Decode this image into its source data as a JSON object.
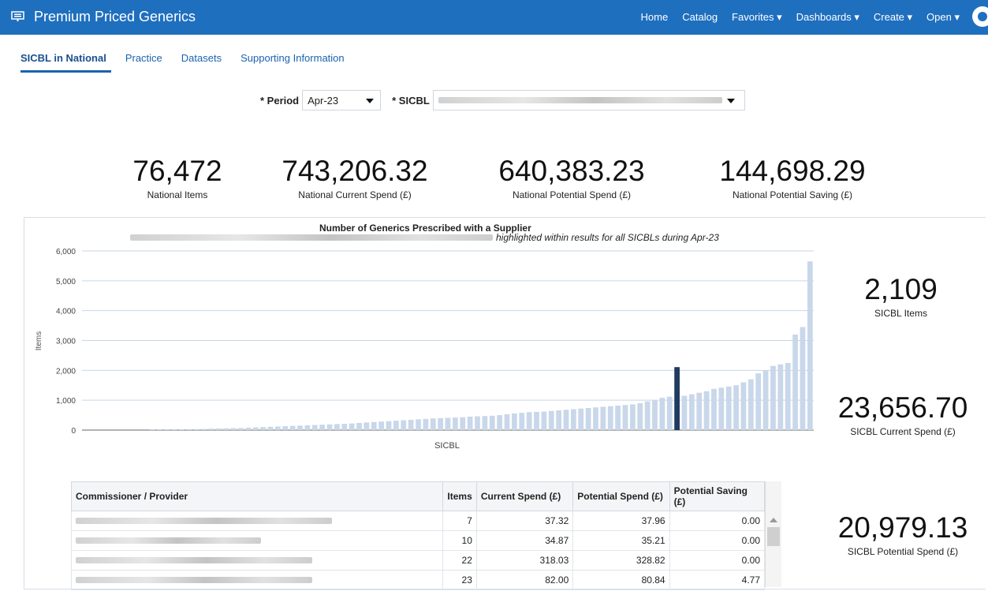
{
  "app": {
    "title": "Premium Priced Generics"
  },
  "nav": {
    "home": "Home",
    "catalog": "Catalog",
    "favorites": "Favorites ▾",
    "dashboards": "Dashboards ▾",
    "create": "Create ▾",
    "open": "Open ▾"
  },
  "tabs": [
    "SICBL in National",
    "Practice",
    "Datasets",
    "Supporting Information"
  ],
  "filters": {
    "period_label": "* Period",
    "period_value": "Apr-23",
    "sicbl_label": "* SICBL"
  },
  "kpis": [
    {
      "value": "76,472",
      "label": "National Items"
    },
    {
      "value": "743,206.32",
      "label": "National Current Spend (£)"
    },
    {
      "value": "640,383.23",
      "label": "National Potential Spend (£)"
    },
    {
      "value": "144,698.29",
      "label": "National Potential Saving (£)"
    }
  ],
  "side_kpis": [
    {
      "value": "2,109",
      "label": "SICBL Items"
    },
    {
      "value": "23,656.70",
      "label": "SICBL Current Spend (£)"
    },
    {
      "value": "20,979.13",
      "label": "SICBL Potential Spend (£)"
    }
  ],
  "colors": {
    "bar": "#c9d7ea",
    "highlight": "#1f3b5e",
    "brand": "#1f6fbf"
  },
  "chart_data": {
    "type": "bar",
    "title": "Number of Generics Prescribed with a Supplier",
    "subtitle": "highlighted within results for all SICBLs during Apr-23",
    "xlabel": "SICBL",
    "ylabel": "Items",
    "ylim": [
      0,
      6000
    ],
    "yticks": [
      "0",
      "1,000",
      "2,000",
      "3,000",
      "4,000",
      "5,000",
      "6,000"
    ],
    "highlight_index": 80,
    "values": [
      0,
      0,
      0,
      0,
      0,
      0,
      0,
      0,
      0,
      5,
      10,
      15,
      20,
      25,
      30,
      35,
      40,
      50,
      55,
      60,
      65,
      70,
      80,
      90,
      100,
      110,
      120,
      130,
      140,
      150,
      160,
      170,
      180,
      190,
      200,
      210,
      220,
      240,
      255,
      270,
      285,
      300,
      315,
      330,
      345,
      360,
      375,
      390,
      400,
      410,
      420,
      430,
      450,
      460,
      470,
      480,
      500,
      530,
      560,
      580,
      600,
      610,
      620,
      640,
      660,
      680,
      700,
      720,
      740,
      760,
      780,
      800,
      820,
      840,
      860,
      900,
      960,
      1000,
      1080,
      1120,
      2109,
      1150,
      1200,
      1250,
      1300,
      1380,
      1420,
      1460,
      1500,
      1600,
      1700,
      1900,
      2000,
      2150,
      2200,
      2250,
      3200,
      3450,
      5650
    ],
    "note": ""
  },
  "table": {
    "headers": [
      "Commissioner / Provider",
      "Items",
      "Current Spend (£)",
      "Potential Spend (£)",
      "Potential Saving (£)"
    ],
    "rows": [
      {
        "items": "7",
        "current": "37.32",
        "potential": "37.96",
        "saving": "0.00"
      },
      {
        "items": "10",
        "current": "34.87",
        "potential": "35.21",
        "saving": "0.00"
      },
      {
        "items": "22",
        "current": "318.03",
        "potential": "328.82",
        "saving": "0.00"
      },
      {
        "items": "23",
        "current": "82.00",
        "potential": "80.84",
        "saving": "4.77"
      }
    ]
  }
}
